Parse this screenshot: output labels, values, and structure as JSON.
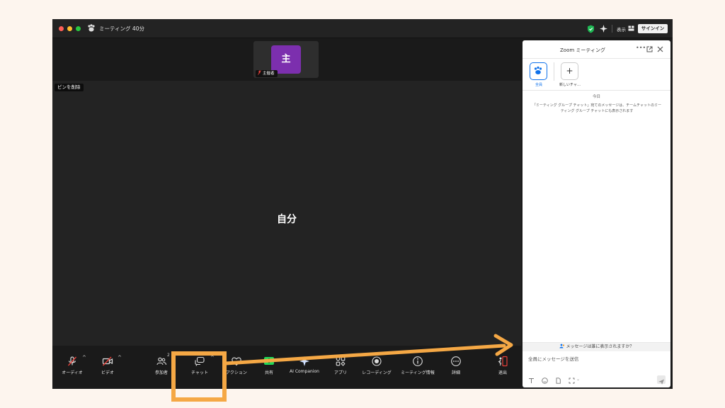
{
  "window": {
    "meeting_title": "ミーティング 40分",
    "view_label": "表示",
    "signin_label": "サインイン"
  },
  "stage": {
    "host_avatar_letter": "主",
    "host_name": "主催者",
    "unpin_label": "ピンを削除",
    "self_center_label": "自分",
    "self_name": "自分"
  },
  "toolbar": {
    "audio_label": "オーディオ",
    "video_label": "ビデオ",
    "participants_label": "参加者",
    "participants_count": "2",
    "chat_label": "チャット",
    "actions_label": "アクション",
    "share_label": "共有",
    "ai_label": "AI Companion",
    "apps_label": "アプリ",
    "record_label": "レコーディング",
    "info_label": "ミーティング情報",
    "more_label": "詳細",
    "leave_label": "退出"
  },
  "chat": {
    "title": "Zoom ミーティング",
    "target_all_label": "全員",
    "target_new_label": "新しいチャ…",
    "date_label": "今日",
    "notice": "「ミーティング グループ チャット」宛てのメッセージは、チームチャットのミーティング グループ チャットにも表示されます",
    "who_can_see": "メッセージは誰に表示されますか？",
    "input_placeholder": "全員にメッセージを送信"
  },
  "colors": {
    "highlight": "#f5a845",
    "brand_blue": "#0e71eb",
    "avatar_purple": "#7c2fae",
    "share_green": "#23d959",
    "muted_red": "#e8403a"
  }
}
